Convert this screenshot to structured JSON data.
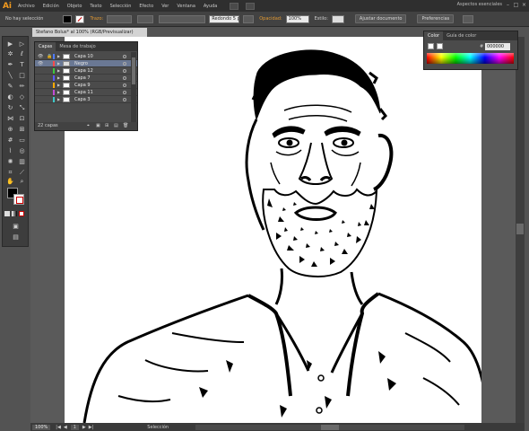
{
  "app": {
    "logo": "Ai",
    "menu": [
      "Archivo",
      "Edición",
      "Objeto",
      "Texto",
      "Selección",
      "Efecto",
      "Ver",
      "Ventana",
      "Ayuda"
    ],
    "workspace": "Aspectos esenciales",
    "window_controls": [
      "–",
      "□",
      "×"
    ]
  },
  "control_bar": {
    "selection_status": "No hay selección",
    "stroke_label": "Trazo:",
    "brush_preset": "Redondo 5 pt.",
    "opacity_label": "Opacidad:",
    "opacity_value": "100%",
    "style_label": "Estilo:",
    "doc_setup_button": "Ajustar documento",
    "preferences_button": "Preferencias"
  },
  "document": {
    "tab_title": "Stefano Bolus* al 100% (RGB/Previsualizar)"
  },
  "layers_panel": {
    "tabs": [
      "Capas",
      "Mesa de trabajo"
    ],
    "layers": [
      {
        "name": "Capa 10",
        "color": "#4f7bff",
        "selected": false
      },
      {
        "name": "Negro",
        "color": "#ff4a4a",
        "selected": true
      },
      {
        "name": "Capa 12",
        "color": "#3ec83e",
        "selected": false
      },
      {
        "name": "Capa 7",
        "color": "#5a5aff",
        "selected": false
      },
      {
        "name": "Capa 9",
        "color": "#ffaa00",
        "selected": false
      },
      {
        "name": "Capa 11",
        "color": "#c24cd6",
        "selected": false
      },
      {
        "name": "Capa 3",
        "color": "#3ec8c8",
        "selected": false
      }
    ],
    "footer_count": "22 capas"
  },
  "color_panel": {
    "tabs": [
      "Color",
      "Guía de color"
    ],
    "hex_value": "000000"
  },
  "status_bar": {
    "zoom": "100%",
    "page": "1",
    "tool_status": "Selección"
  }
}
